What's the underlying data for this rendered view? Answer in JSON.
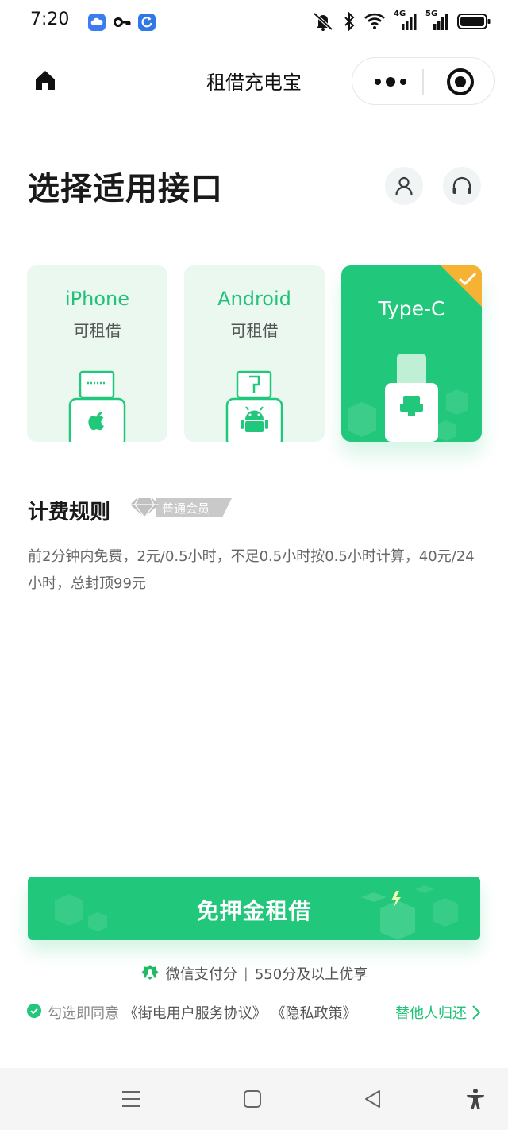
{
  "status_bar": {
    "time": "7:20",
    "left_icons": [
      "cloud-icon",
      "key-icon",
      "refresh-icon"
    ],
    "right_icons": [
      "mute-icon",
      "bluetooth-icon",
      "wifi-icon",
      "signal-4g-icon",
      "signal-5g-icon",
      "battery-icon"
    ],
    "signal_labels": {
      "lte": "4G",
      "nr": "5G"
    }
  },
  "nav": {
    "title": "租借充电宝",
    "icons": {
      "home": "home-icon",
      "more": "more-dots-icon",
      "close": "mini-program-close-icon"
    }
  },
  "header": {
    "title": "选择适用接口",
    "icons": {
      "user": "user-icon",
      "service": "headset-icon"
    }
  },
  "interfaces": [
    {
      "name": "iPhone",
      "status": "可租借",
      "selected": false,
      "icon": "apple-lightning-icon"
    },
    {
      "name": "Android",
      "status": "可租借",
      "selected": false,
      "icon": "android-micro-usb-icon"
    },
    {
      "name": "Type-C",
      "status": "",
      "selected": true,
      "icon": "usb-type-c-icon"
    }
  ],
  "billing": {
    "title": "计费规则",
    "member_level": "普通会员",
    "rule": "前2分钟内免费，2元/0.5小时，不足0.5小时按0.5小时计算，40元/24小时，总封顶99元"
  },
  "rent_button": {
    "label": "免押金租借"
  },
  "payment": {
    "icon": "wechat-pay-score-icon",
    "name": "微信支付分",
    "separator": "|",
    "benefit": "550分及以上优享"
  },
  "agreement": {
    "prefix": "勾选即同意",
    "service_agreement": "《街电用户服务协议》",
    "privacy_policy": "《隐私政策》",
    "return_for_others": "替他人归还"
  },
  "colors": {
    "brand_green": "#21c77a",
    "card_bg": "#ebf8f0",
    "badge_orange": "#f5b233"
  }
}
